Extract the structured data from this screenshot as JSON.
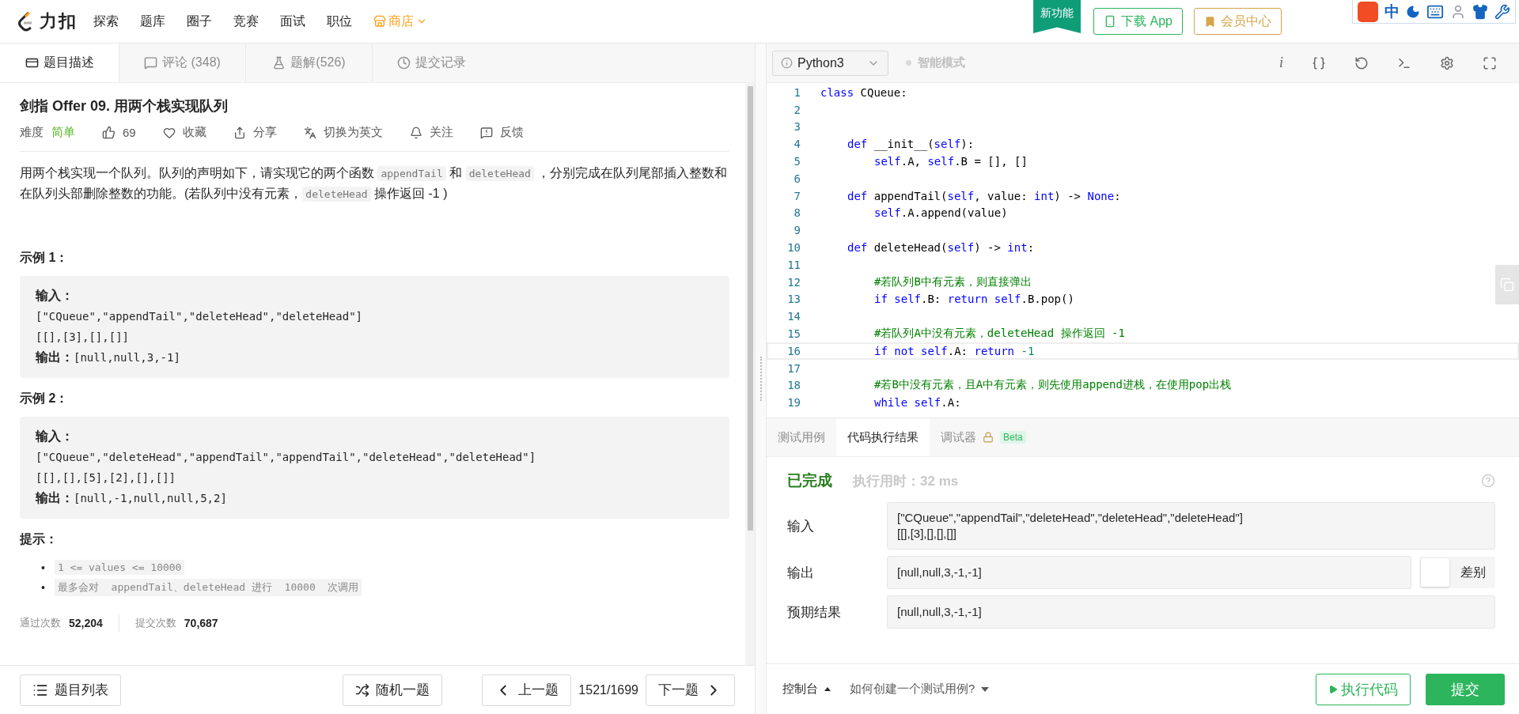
{
  "header": {
    "logo": "力扣",
    "nav": [
      {
        "label": "探索",
        "kind": "plain"
      },
      {
        "label": "题库",
        "kind": "plain"
      },
      {
        "label": "圈子",
        "kind": "plain"
      },
      {
        "label": "竞赛",
        "kind": "plain"
      },
      {
        "label": "面试",
        "kind": "plain"
      },
      {
        "label": "职位",
        "kind": "plain"
      },
      {
        "label": "商店",
        "kind": "shop"
      }
    ],
    "new_badge": "新功能",
    "download": "下载 App",
    "member": "会员中心"
  },
  "ime_toolbar": {
    "mode": "中"
  },
  "left_tabs": [
    {
      "label": "题目描述",
      "selected": true
    },
    {
      "label": "评论 (348)",
      "selected": false
    },
    {
      "label": "题解(526)",
      "selected": false
    },
    {
      "label": "提交记录",
      "selected": false
    }
  ],
  "problem": {
    "title": "剑指 Offer 09. 用两个栈实现队列",
    "meta": {
      "difficulty_label": "难度",
      "difficulty": "简单",
      "likes": "69",
      "actions": [
        "收藏",
        "分享",
        "切换为英文",
        "关注",
        "反馈"
      ]
    },
    "description": [
      {
        "kind": "text",
        "text": "用两个栈实现一个队列。队列的声明如下，请实现它的两个函数 "
      },
      {
        "kind": "code",
        "text": "appendTail"
      },
      {
        "kind": "text",
        "text": " 和 "
      },
      {
        "kind": "code",
        "text": "deleteHead"
      },
      {
        "kind": "text",
        "text": " ，分别完成在队列尾部插入整数和在队列头部删除整数的功能。(若队列中没有元素，"
      },
      {
        "kind": "code",
        "text": "deleteHead"
      },
      {
        "kind": "text",
        "text": " 操作返回 -1 )"
      }
    ],
    "examples": [
      {
        "title": "示例 1：",
        "lines": [
          {
            "label": "输入："
          },
          {
            "code": "[\"CQueue\",\"appendTail\",\"deleteHead\",\"deleteHead\"]"
          },
          {
            "code": "[[],[3],[],[]]"
          },
          {
            "label": "输出：",
            "code": "[null,null,3,-1]"
          }
        ]
      },
      {
        "title": "示例 2：",
        "lines": [
          {
            "label": "输入："
          },
          {
            "code": "[\"CQueue\",\"deleteHead\",\"appendTail\",\"appendTail\",\"deleteHead\",\"deleteHead\"]"
          },
          {
            "code": "[[],[],[5],[2],[],[]]"
          },
          {
            "label": "输出：",
            "code": "[null,-1,null,null,5,2]"
          }
        ]
      }
    ],
    "hints_title": "提示：",
    "hints": [
      {
        "marker": "•",
        "text": "1 <= values <= 10000"
      },
      {
        "marker": "•",
        "text": "最多会对  appendTail、deleteHead 进行  10000  次调用"
      }
    ],
    "stats": [
      {
        "label": "通过次数",
        "value": "52,204"
      },
      {
        "label": "提交次数",
        "value": "70,687"
      }
    ]
  },
  "left_footer": {
    "list": "题目列表",
    "random": "随机一题",
    "prev": "上一题",
    "position": "1521/1699",
    "next": "下一题"
  },
  "editor_toolbar": {
    "language": "Python3",
    "smart_mode": "智能模式",
    "smart_mode_on": false,
    "info": "i"
  },
  "code": [
    {
      "number": "1",
      "current": false,
      "kind": "top",
      "tokens": [
        {
          "kind": "keyword",
          "text": "class"
        },
        {
          "kind": "plain",
          "text": " CQueue:"
        }
      ]
    },
    {
      "number": "2",
      "current": false
    },
    {
      "number": "3",
      "current": false
    },
    {
      "number": "4",
      "current": false,
      "kind": "method",
      "tokens": [
        {
          "kind": "keyword",
          "text": "def"
        },
        {
          "kind": "plain",
          "text": " __init__("
        },
        {
          "kind": "keyword",
          "text": "self"
        },
        {
          "kind": "plain",
          "text": "):"
        }
      ]
    },
    {
      "number": "5",
      "current": false,
      "kind": "body",
      "tokens": [
        {
          "kind": "keyword",
          "text": "self"
        },
        {
          "kind": "plain",
          "text": ".A, "
        },
        {
          "kind": "keyword",
          "text": "self"
        },
        {
          "kind": "plain",
          "text": ".B = [], []"
        }
      ]
    },
    {
      "number": "6",
      "current": false
    },
    {
      "number": "7",
      "current": false,
      "kind": "method",
      "tokens": [
        {
          "kind": "keyword",
          "text": "def"
        },
        {
          "kind": "plain",
          "text": " appendTail("
        },
        {
          "kind": "keyword",
          "text": "self"
        },
        {
          "kind": "plain",
          "text": ", value: "
        },
        {
          "kind": "keyword",
          "text": "int"
        },
        {
          "kind": "plain",
          "text": ") -> "
        },
        {
          "kind": "keyword",
          "text": "None"
        },
        {
          "kind": "plain",
          "text": ":"
        }
      ]
    },
    {
      "number": "8",
      "current": false,
      "kind": "body",
      "tokens": [
        {
          "kind": "keyword",
          "text": "self"
        },
        {
          "kind": "plain",
          "text": ".A.append(value)"
        }
      ]
    },
    {
      "number": "9",
      "current": false
    },
    {
      "number": "10",
      "current": false,
      "kind": "method",
      "tokens": [
        {
          "kind": "keyword",
          "text": "def"
        },
        {
          "kind": "plain",
          "text": " deleteHead("
        },
        {
          "kind": "keyword",
          "text": "self"
        },
        {
          "kind": "plain",
          "text": ") -> "
        },
        {
          "kind": "keyword",
          "text": "int"
        },
        {
          "kind": "plain",
          "text": ":"
        }
      ]
    },
    {
      "number": "11",
      "current": false
    },
    {
      "number": "12",
      "current": false,
      "kind": "body",
      "tokens": [
        {
          "kind": "comment",
          "text": "#若队列B中有元素，则直接弹出"
        }
      ]
    },
    {
      "number": "13",
      "current": false,
      "kind": "body",
      "tokens": [
        {
          "kind": "keyword",
          "text": "if"
        },
        {
          "kind": "keyword",
          "text": " self"
        },
        {
          "kind": "plain",
          "text": ".B: "
        },
        {
          "kind": "keyword",
          "text": "return"
        },
        {
          "kind": "keyword",
          "text": " self"
        },
        {
          "kind": "plain",
          "text": ".B.pop()"
        }
      ]
    },
    {
      "number": "14",
      "current": false
    },
    {
      "number": "15",
      "current": false,
      "kind": "body",
      "tokens": [
        {
          "kind": "comment",
          "text": "#若队列A中没有元素，deleteHead 操作返回 -1"
        }
      ]
    },
    {
      "number": "16",
      "current": true,
      "kind": "body",
      "tokens": [
        {
          "kind": "keyword",
          "text": "if"
        },
        {
          "kind": "keyword",
          "text": " not"
        },
        {
          "kind": "keyword",
          "text": " self"
        },
        {
          "kind": "plain",
          "text": ".A: "
        },
        {
          "kind": "keyword",
          "text": "return"
        },
        {
          "kind": "number",
          "text": " -1"
        }
      ]
    },
    {
      "number": "17",
      "current": false
    },
    {
      "number": "18",
      "current": false,
      "kind": "body",
      "tokens": [
        {
          "kind": "comment",
          "text": "#若B中没有元素，且A中有元素，则先使用append进栈，在使用pop出栈"
        }
      ]
    },
    {
      "number": "19",
      "current": false,
      "kind": "body",
      "tokens": [
        {
          "kind": "keyword",
          "text": "while"
        },
        {
          "kind": "keyword",
          "text": " self"
        },
        {
          "kind": "plain",
          "text": ".A:"
        }
      ]
    }
  ],
  "result_tabs": [
    {
      "label": "测试用例",
      "selected": false
    },
    {
      "label": "代码执行结果",
      "selected": true
    },
    {
      "label": "调试器",
      "selected": false,
      "locked": true,
      "badge": "Beta"
    }
  ],
  "result": {
    "status": "已完成",
    "runtime": "执行用时：32 ms",
    "rows": [
      {
        "label": "输入",
        "lines": [
          "[\"CQueue\",\"appendTail\",\"deleteHead\",\"deleteHead\",\"deleteHead\"]",
          "[[],[3],[],[],[]]"
        ]
      },
      {
        "label": "输出",
        "lines": [
          "[null,null,3,-1,-1]"
        ],
        "diff": {
          "label": "差别",
          "on": false
        }
      },
      {
        "label": "预期结果",
        "lines": [
          "[null,null,3,-1,-1]"
        ]
      }
    ]
  },
  "right_footer": {
    "console": "控制台",
    "howto": "如何创建一个测试用例?",
    "run": "执行代码",
    "submit": "提交"
  }
}
